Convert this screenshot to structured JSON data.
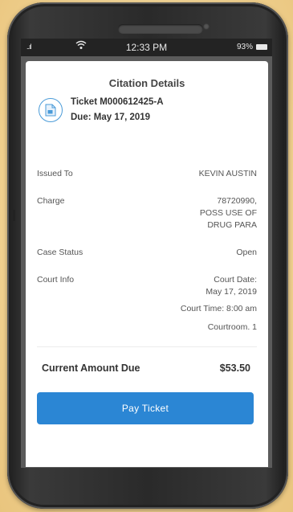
{
  "statusbar": {
    "signal": "..ıl",
    "time": "12:33 PM",
    "battery": "93%"
  },
  "citation": {
    "title": "Citation Details",
    "ticket_number": "Ticket M000612425-A",
    "due": "Due: May 17, 2019"
  },
  "rows": {
    "issued_to": {
      "label": "Issued To",
      "value": "KEVIN AUSTIN"
    },
    "charge": {
      "label": "Charge",
      "line1": "78720990,",
      "line2": "POSS USE OF",
      "line3": "DRUG PARA"
    },
    "case_status": {
      "label": "Case Status",
      "value": "Open"
    },
    "court_info": {
      "label": "Court Info",
      "date_line1": "Court Date:",
      "date_line2": "May 17, 2019",
      "time": "Court Time: 8:00 am",
      "room": "Courtroom. 1"
    }
  },
  "amount": {
    "label": "Current Amount Due",
    "value": "$53.50"
  },
  "pay_button": {
    "label": "Pay Ticket"
  },
  "colors": {
    "accent": "#2b86d4",
    "icon_ring": "#4a9bd8"
  },
  "icons": {
    "ticket": "document-icon",
    "wifi": "wifi-icon",
    "battery": "battery-icon"
  }
}
